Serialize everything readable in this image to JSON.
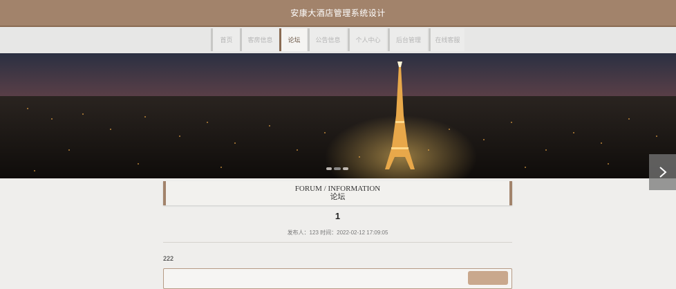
{
  "header": {
    "title": "安康大酒店管理系统设计"
  },
  "nav": {
    "items": [
      {
        "label": "首页"
      },
      {
        "label": "客房信息"
      },
      {
        "label": "论坛"
      },
      {
        "label": "公告信息"
      },
      {
        "label": "个人中心"
      },
      {
        "label": "后台管理"
      },
      {
        "label": "在线客服"
      }
    ],
    "active": "论坛"
  },
  "banner": {
    "image": "paris-night-eiffel-tower",
    "slides_count": 3,
    "active_slide": 1,
    "next_icon": "chevron-right-icon"
  },
  "section": {
    "title_en": "FORUM / INFORMATION",
    "title_cn": "论坛"
  },
  "post": {
    "title": "1",
    "meta": "发布人：123 时间：2022-02-12 17:09:05",
    "content": "222"
  },
  "colors": {
    "brand": "#a2836b",
    "brand_dark": "#8a6b53",
    "button": "#c9a88d",
    "background": "#efeeec"
  }
}
